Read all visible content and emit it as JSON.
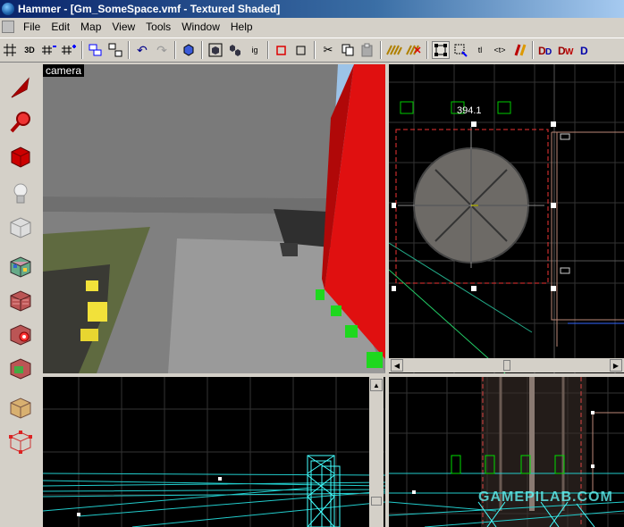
{
  "window": {
    "title": "Hammer - [Gm_SomeSpace.vmf - Textured Shaded]"
  },
  "menu": [
    "File",
    "Edit",
    "Map",
    "View",
    "Tools",
    "Window",
    "Help"
  ],
  "toolbar": {
    "grid_3d_label": "3D",
    "ig_label": "ig",
    "tl_label": "tl",
    "arrow_label": "<t>"
  },
  "viewports": {
    "camera": {
      "label": "camera"
    },
    "top": {
      "dimension": "394.1"
    }
  },
  "watermark": "GAMEPILAB.COM",
  "colors": {
    "title_start": "#0a246a",
    "title_end": "#a6caf0",
    "grid": "#3a3a3a",
    "selection": "#ff4040",
    "cyan_wire": "#30e0e0"
  }
}
